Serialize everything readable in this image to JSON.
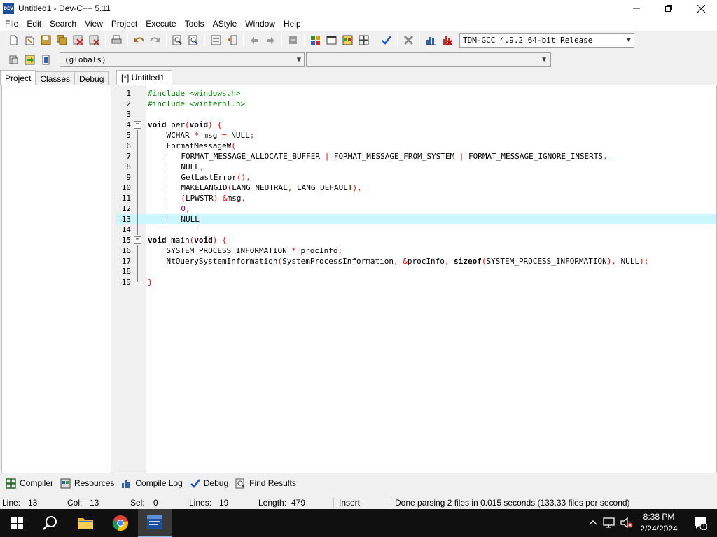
{
  "window": {
    "title": "Untitled1 - Dev-C++ 5.11",
    "app_icon_text": "DEV"
  },
  "menu": [
    "File",
    "Edit",
    "Search",
    "View",
    "Project",
    "Execute",
    "Tools",
    "AStyle",
    "Window",
    "Help"
  ],
  "toolbar": {
    "compiler": "TDM-GCC 4.9.2 64-bit Release",
    "scope": "(globals)"
  },
  "left_tabs": [
    "Project",
    "Classes",
    "Debug"
  ],
  "editor_tab": "[*] Untitled1",
  "code": {
    "line_numbers": [
      "1",
      "2",
      "3",
      "4",
      "5",
      "6",
      "7",
      "8",
      "9",
      "10",
      "11",
      "12",
      "13",
      "14",
      "15",
      "16",
      "17",
      "18",
      "19"
    ],
    "l1": "#include <windows.h>",
    "l2": "#include <winternl.h>",
    "l4_kw1": "void",
    "l4_name": " per",
    "l4_p1": "(",
    "l4_kw2": "void",
    "l4_p2": ")",
    "l4_sp": " ",
    "l4_b": "{",
    "l5_a": "WCHAR ",
    "l5_s1": "*",
    "l5_b": " msg ",
    "l5_s2": "=",
    "l5_c": " NULL",
    "l5_s3": ";",
    "l6_a": "FormatMessageW",
    "l6_s": "(",
    "l7_a": "FORMAT_MESSAGE_ALLOCATE_BUFFER ",
    "l7_s1": "|",
    "l7_b": " FORMAT_MESSAGE_FROM_SYSTEM ",
    "l7_s2": "|",
    "l7_c": " FORMAT_MESSAGE_IGNORE_INSERTS",
    "l7_s3": ",",
    "l8_a": "NULL",
    "l8_s": ",",
    "l9_a": "GetLastError",
    "l9_s": "(),",
    "l10_a": "MAKELANGID",
    "l10_s1": "(",
    "l10_b": "LANG_NEUTRAL",
    "l10_s2": ",",
    "l10_c": " LANG_DEFAULT",
    "l10_s3": "),",
    "l11_s1": "(",
    "l11_a": "LPWSTR",
    "l11_s2": ")",
    "l11_sp": " ",
    "l11_s3": "&",
    "l11_b": "msg",
    "l11_s4": ",",
    "l12_n": "0",
    "l12_s": ",",
    "l13_a": "NULL",
    "l15_kw1": "void",
    "l15_name": " main",
    "l15_p1": "(",
    "l15_kw2": "void",
    "l15_p2": ")",
    "l15_sp": " ",
    "l15_b": "{",
    "l16_a": "SYSTEM_PROCESS_INFORMATION ",
    "l16_s1": "*",
    "l16_b": " procInfo",
    "l16_s2": ";",
    "l17_a": "NtQuerySystemInformation",
    "l17_s1": "(",
    "l17_b": "SystemProcessInformation",
    "l17_s2": ",",
    "l17_sp": " ",
    "l17_s3": "&",
    "l17_c": "procInfo",
    "l17_s4": ",",
    "l17_sp2": " ",
    "l17_kw": "sizeof",
    "l17_s5": "(",
    "l17_d": "SYSTEM_PROCESS_INFORMATION",
    "l17_s6": "),",
    "l17_e": " NULL",
    "l17_s7": ");",
    "l19_b": "}"
  },
  "bottom_tabs": [
    "Compiler",
    "Resources",
    "Compile Log",
    "Debug",
    "Find Results"
  ],
  "status": {
    "line_label": "Line:",
    "line_val": "13",
    "col_label": "Col:",
    "col_val": "13",
    "sel_label": "Sel:",
    "sel_val": "0",
    "lines_label": "Lines:",
    "lines_val": "19",
    "length_label": "Length:",
    "length_val": "479",
    "mode": "Insert",
    "message": "Done parsing 2 files in 0.015 seconds (133.33 files per second)"
  },
  "taskbar": {
    "time": "8:38 PM",
    "date": "2/24/2024",
    "notif_count": "1"
  },
  "colors": {
    "preprocessor": "#008000",
    "symbol": "#ff0000",
    "number": "#800080",
    "current_line": "#ccf7ff",
    "taskbar": "#101010"
  }
}
